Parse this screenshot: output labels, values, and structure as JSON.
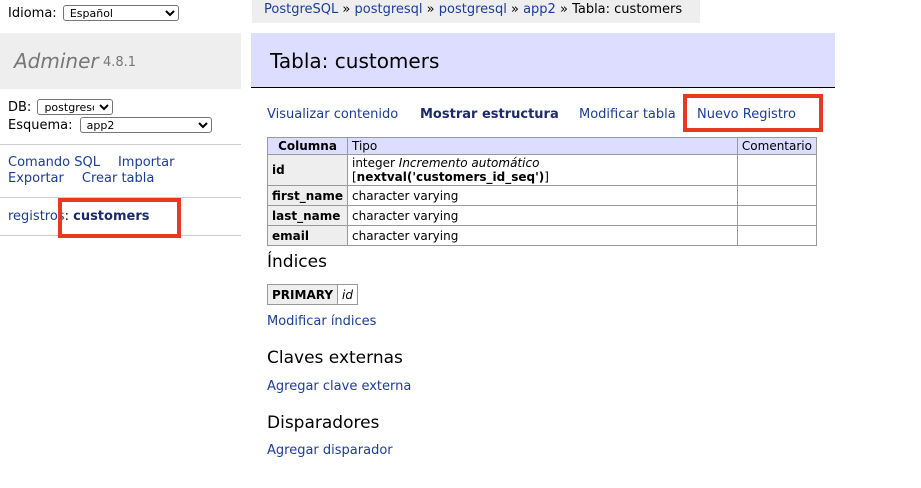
{
  "sidebar": {
    "language_label": "Idioma:",
    "language_value": "Español",
    "app_name": "Adminer",
    "app_version": "4.8.1",
    "db_label": "DB:",
    "db_value": "postgresql",
    "schema_label": "Esquema:",
    "schema_value": "app2",
    "links": [
      "Comando SQL",
      "Importar",
      "Exportar",
      "Crear tabla"
    ],
    "table_prefix": "registros",
    "table_sep": ":",
    "table_name": "customers"
  },
  "breadcrumb": {
    "items": [
      "PostgreSQL",
      "postgresql",
      "postgresql",
      "app2"
    ],
    "sep": "»",
    "current": "Tabla: customers"
  },
  "page": {
    "title": "Tabla: customers",
    "tabs": [
      "Visualizar contenido",
      "Mostrar estructura",
      "Modificar tabla",
      "Nuevo Registro"
    ],
    "active_tab": "Mostrar estructura"
  },
  "structure": {
    "headers": [
      "Columna",
      "Tipo",
      "Comentario"
    ],
    "rows": [
      {
        "name": "id",
        "type": "integer",
        "extra_italic": "Incremento automático",
        "default_open": "[",
        "default_bold": "nextval('customers_id_seq')",
        "default_close": "]",
        "comment": ""
      },
      {
        "name": "first_name",
        "type": "character varying",
        "comment": ""
      },
      {
        "name": "last_name",
        "type": "character varying",
        "comment": ""
      },
      {
        "name": "email",
        "type": "character varying",
        "comment": ""
      }
    ]
  },
  "indexes": {
    "heading": "Índices",
    "type": "PRIMARY",
    "column": "id",
    "modify_link": "Modificar índices"
  },
  "foreign_keys": {
    "heading": "Claves externas",
    "add_link": "Agregar clave externa"
  },
  "triggers": {
    "heading": "Disparadores",
    "add_link": "Agregar disparador"
  },
  "highlight_color": "#e8381e"
}
